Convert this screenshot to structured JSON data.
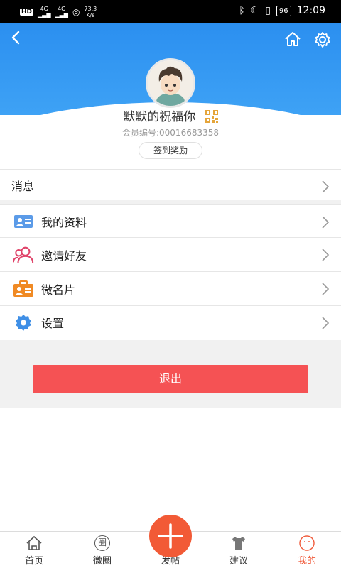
{
  "status_bar": {
    "net1": "4G",
    "net2": "4G",
    "speed": "73.3",
    "speed_unit": "K/s",
    "battery": "96",
    "time": "12:09"
  },
  "profile": {
    "username": "默默的祝福你",
    "member_no": "会员编号:00016683358",
    "checkin_label": "签到奖励"
  },
  "menu": {
    "messages": "消息",
    "items": [
      {
        "label": "我的资料",
        "icon": "profile-card-icon"
      },
      {
        "label": "邀请好友",
        "icon": "invite-users-icon"
      },
      {
        "label": "微名片",
        "icon": "business-card-icon"
      },
      {
        "label": "设置",
        "icon": "settings-gear-icon"
      }
    ]
  },
  "logout_label": "退出",
  "tabs": [
    {
      "label": "首页",
      "icon": "home-icon"
    },
    {
      "label": "微圈",
      "icon": "circle-icon",
      "icon_text": "圈"
    },
    {
      "label": "发帖",
      "icon": "plus-icon"
    },
    {
      "label": "建议",
      "icon": "shirt-icon"
    },
    {
      "label": "我的",
      "icon": "user-icon"
    }
  ],
  "colors": {
    "header_blue": "#2b8ff0",
    "accent_orange": "#f25a36",
    "logout_red": "#f55254",
    "qr_gold": "#e5a53a"
  }
}
